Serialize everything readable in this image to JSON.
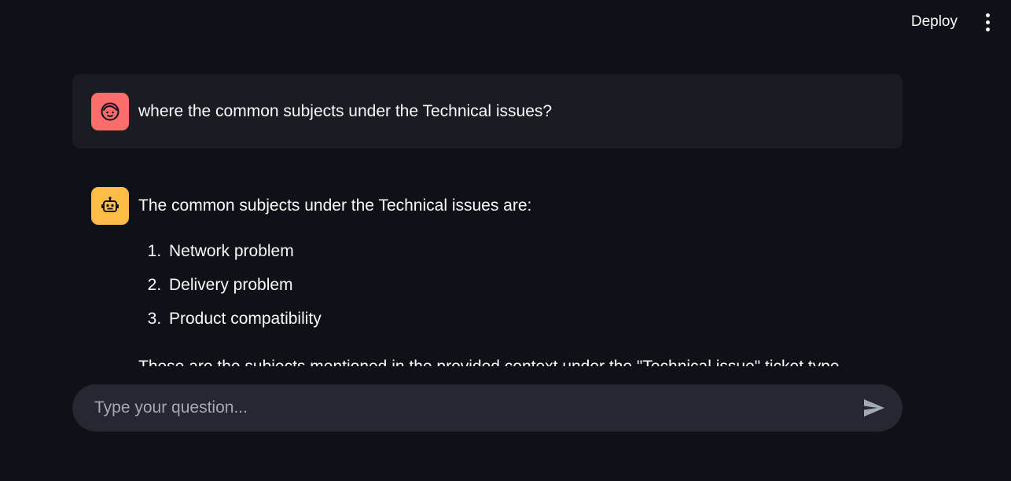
{
  "toolbar": {
    "deploy_label": "Deploy",
    "menu_icon": "vertical-ellipsis-icon"
  },
  "chat": {
    "messages": [
      {
        "role": "user",
        "avatar_icon": "user-face-icon",
        "avatar_color": "#ff6c6c",
        "text": "where the common subjects under the Technical issues?"
      },
      {
        "role": "assistant",
        "avatar_icon": "robot-icon",
        "avatar_color": "#ffbd45",
        "intro": "The common subjects under the Technical issues are:",
        "items": [
          "Network problem",
          "Delivery problem",
          "Product compatibility"
        ],
        "outro": "These are the subjects mentioned in the provided context under the \"Technical issue\" ticket type."
      }
    ]
  },
  "input": {
    "placeholder": "Type your question...",
    "value": "",
    "send_icon": "send-icon"
  },
  "colors": {
    "background": "#0e1117",
    "user_bubble": "#1a1c24",
    "input_background": "#262730",
    "text": "#fafafa"
  }
}
